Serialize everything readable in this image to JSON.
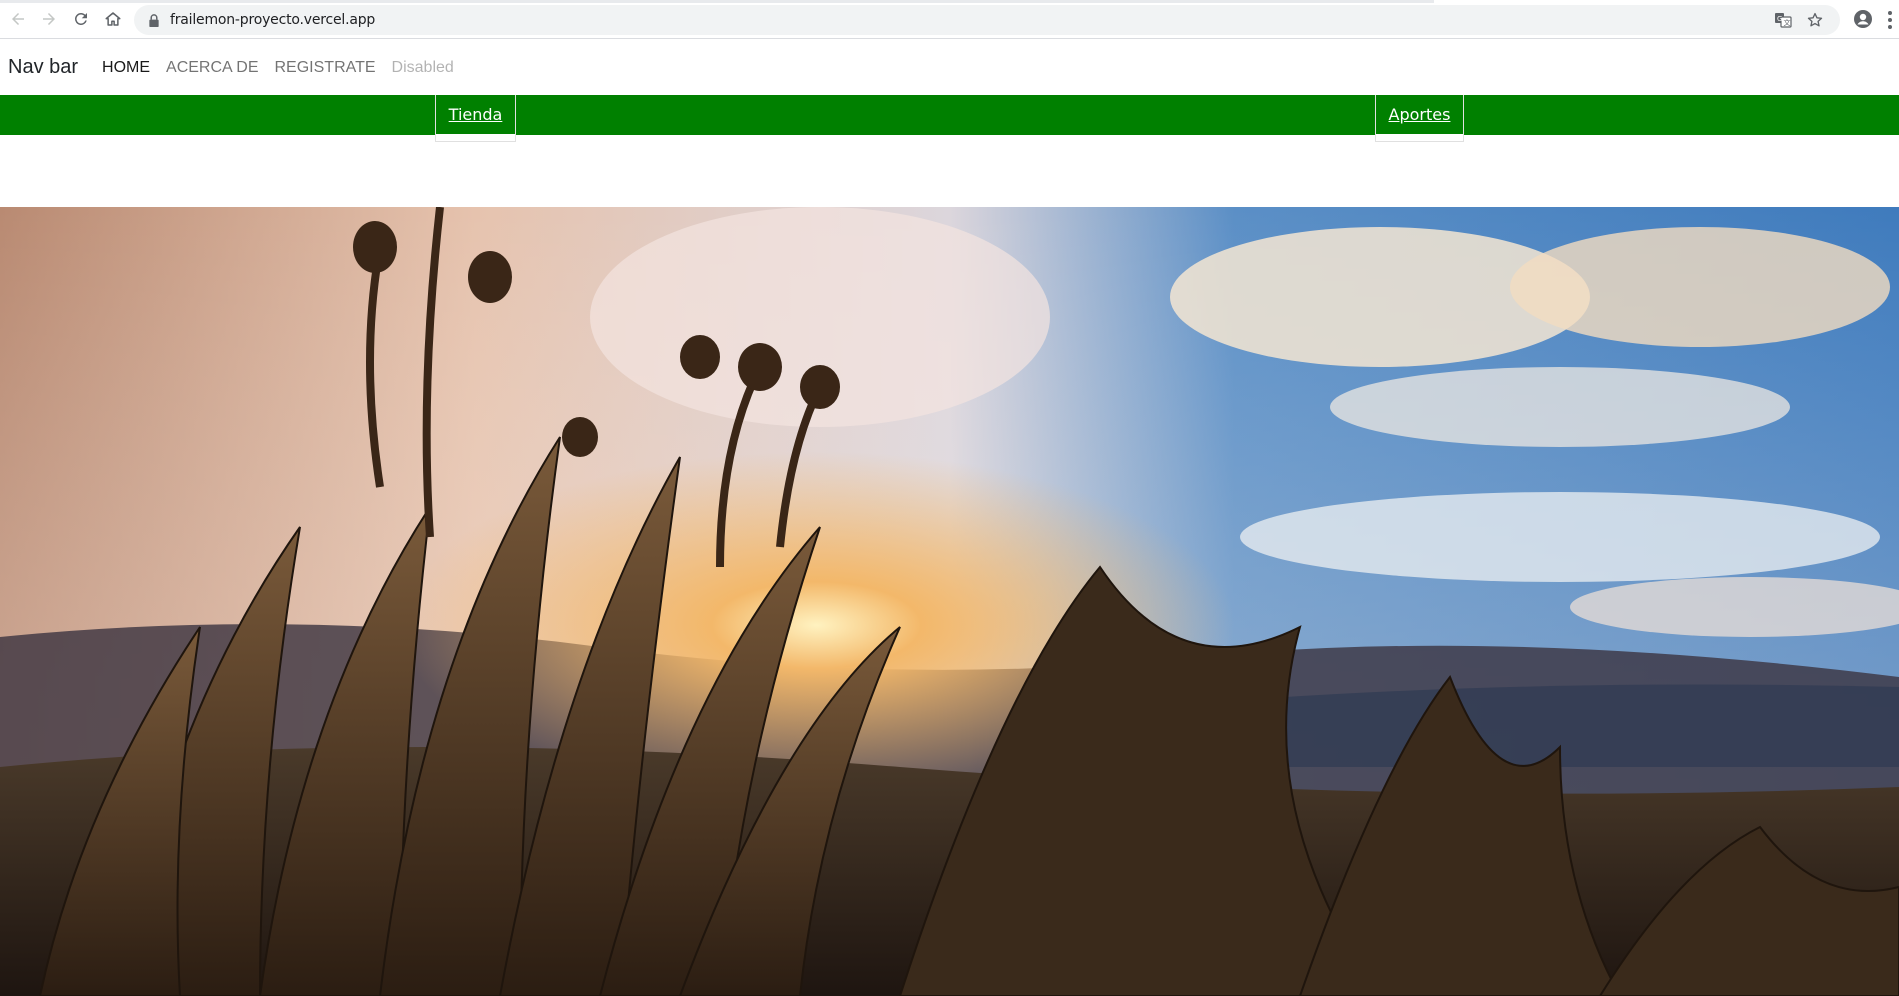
{
  "browser": {
    "url": "frailemon-proyecto.vercel.app",
    "back_icon": "back-arrow-icon",
    "forward_icon": "forward-arrow-icon",
    "reload_icon": "reload-icon",
    "home_icon": "home-icon",
    "lock_icon": "lock-icon",
    "translate_icon": "translate-icon",
    "star_icon": "star-icon",
    "profile_icon": "profile-icon",
    "menu_icon": "kebab-menu-icon"
  },
  "navbar": {
    "brand": "Nav bar",
    "links": [
      {
        "label": "HOME",
        "state": "active"
      },
      {
        "label": "ACERCA DE",
        "state": "normal"
      },
      {
        "label": "REGISTRATE",
        "state": "normal"
      },
      {
        "label": "Disabled",
        "state": "disabled"
      }
    ]
  },
  "subnav": {
    "background": "#008000",
    "tabs": [
      {
        "label": "Tienda"
      },
      {
        "label": "Aportes"
      }
    ]
  },
  "hero": {
    "description_icon": "landscape-photo"
  }
}
